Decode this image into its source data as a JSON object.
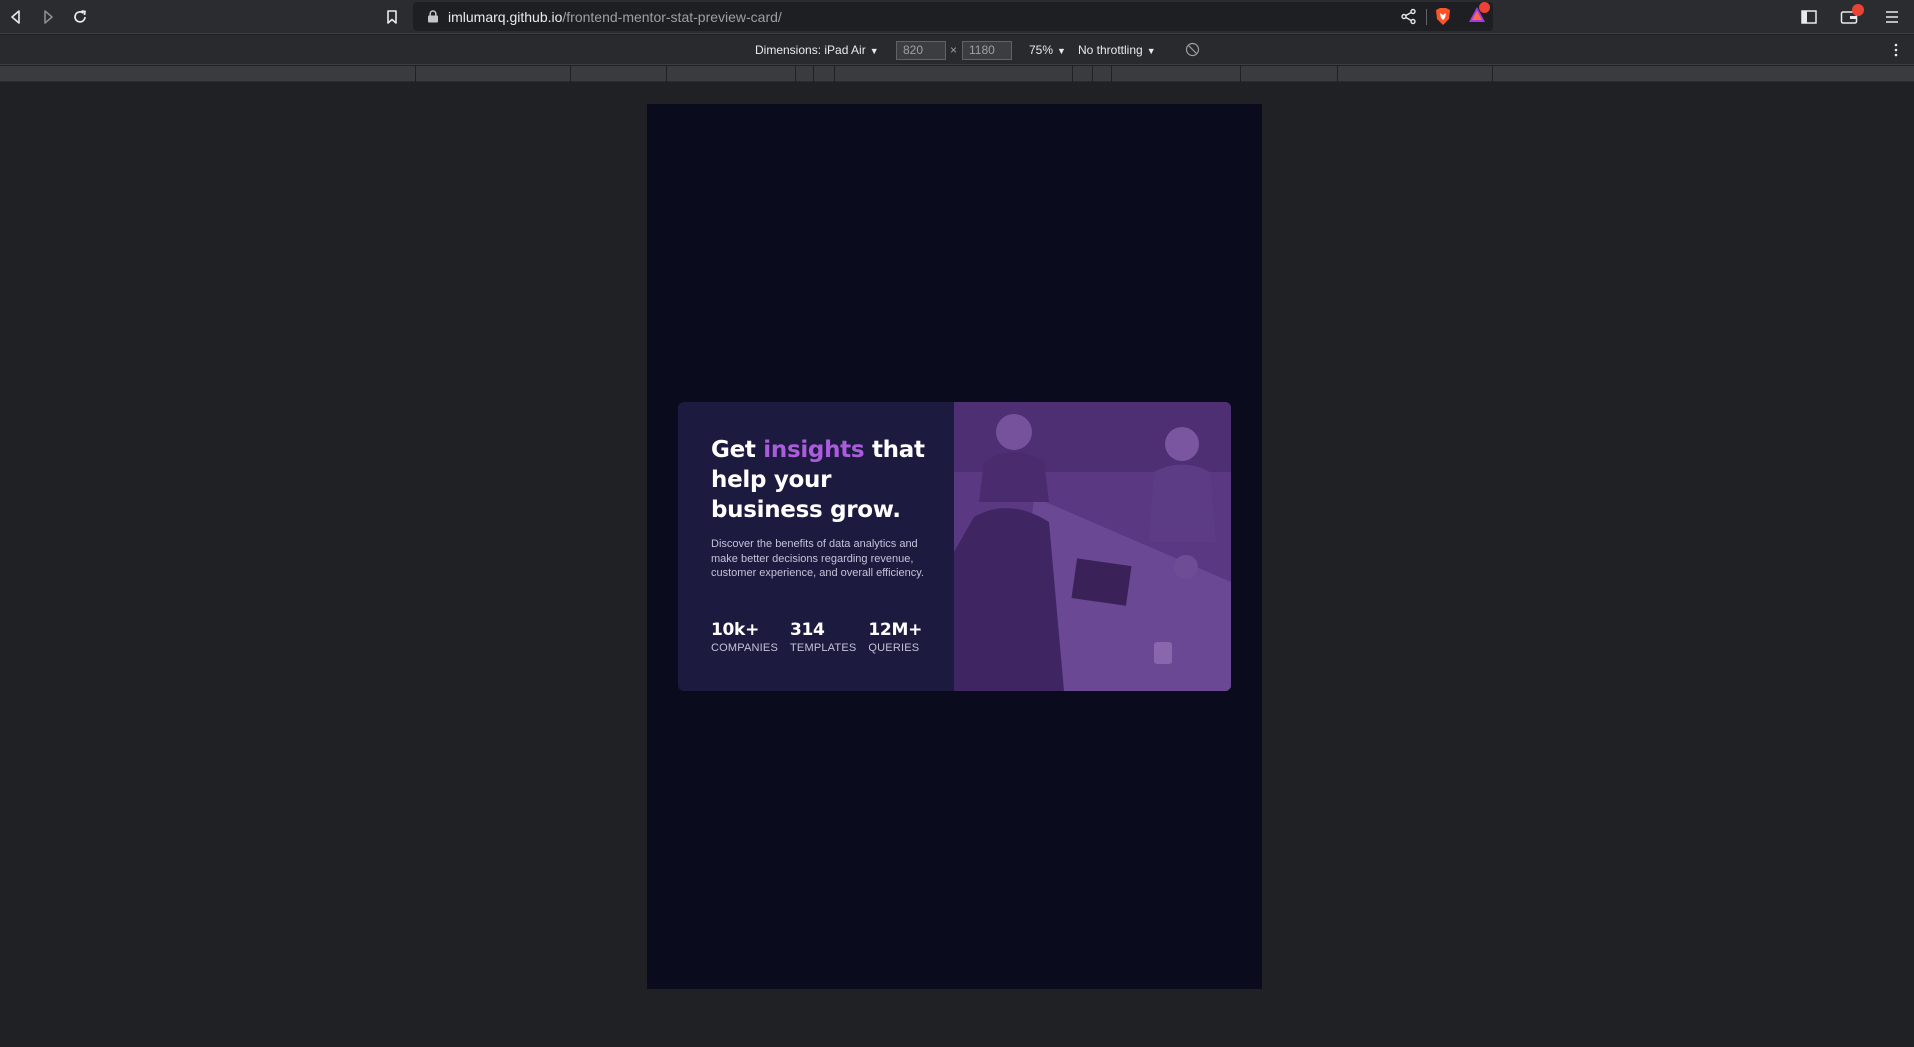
{
  "browser": {
    "url_host": "imlumarq.github.io",
    "url_path": "/frontend-mentor-stat-preview-card/"
  },
  "device_toolbar": {
    "dimensions_label": "Dimensions: iPad Air",
    "width": "820",
    "times": "×",
    "height": "1180",
    "zoom": "75%",
    "throttling": "No throttling"
  },
  "card": {
    "headline_start": "Get ",
    "headline_accent": "insights",
    "headline_end": " that help your business grow.",
    "description": "Discover the benefits of data analytics and make better decisions regarding revenue, customer experience, and overall efficiency.",
    "stats": [
      {
        "value": "10k+",
        "label": "COMPANIES"
      },
      {
        "value": "314",
        "label": "TEMPLATES"
      },
      {
        "value": "12M+",
        "label": "QUERIES"
      }
    ]
  },
  "colors": {
    "page_bg": "#0a0c1d",
    "card_bg": "#1c1a3f",
    "accent": "#aa5cdb",
    "image_tint": "#5e3b86"
  },
  "icons": {
    "back": "back-icon",
    "forward": "forward-icon",
    "reload": "reload-icon",
    "bookmark": "bookmark-icon",
    "lock": "lock-icon",
    "share": "share-icon",
    "brave": "brave-shield-icon",
    "rewards": "brave-rewards-icon",
    "sidebar": "sidebar-icon",
    "wallet": "wallet-icon",
    "menu": "menu-icon",
    "rotate": "rotate-icon",
    "devtools_menu": "kebab-menu-icon"
  }
}
